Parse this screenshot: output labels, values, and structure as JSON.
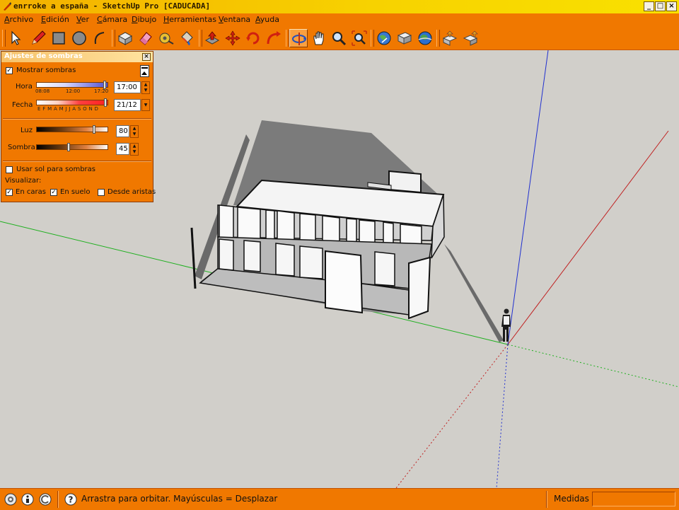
{
  "window": {
    "title": "enrroke a españa - SketchUp Pro [CADUCADA]",
    "buttons": {
      "minimize": "_",
      "maximize": "□",
      "close": "×"
    }
  },
  "menu": [
    "Archivo",
    "Edición",
    "Ver",
    "Cámara",
    "Dibujo",
    "Herramientas",
    "Ventana",
    "Ayuda"
  ],
  "toolbar": {
    "tools": [
      "select-icon",
      "pencil-icon",
      "rectangle-icon",
      "circle-icon",
      "arc-icon",
      "make-component-icon",
      "eraser-icon",
      "tape-measure-icon",
      "paint-bucket-icon",
      "push-pull-icon",
      "move-icon",
      "rotate-icon",
      "follow-me-icon",
      "orbit-icon",
      "pan-icon",
      "zoom-icon",
      "zoom-extents-icon",
      "get-models-icon",
      "share-model-icon",
      "google-earth-icon",
      "import-icon",
      "export-icon"
    ],
    "active_tool": "orbit-icon"
  },
  "shadows_panel": {
    "title": "Ajustes de sombras",
    "close": "×",
    "show_shadows": {
      "label": "Mostrar sombras",
      "checked": true
    },
    "time": {
      "label": "Hora",
      "value": "17:00",
      "ticks": [
        "08:08",
        "12:00",
        "17:20"
      ]
    },
    "date": {
      "label": "Fecha",
      "value": "21/12",
      "months": "E F M A M J J A S O N D"
    },
    "light": {
      "label": "Luz",
      "value": "80"
    },
    "shade": {
      "label": "Sombra",
      "value": "45"
    },
    "use_sun": {
      "label": "Usar sol para sombras",
      "checked": false
    },
    "display": {
      "label": "Visualizar:",
      "on_faces": {
        "label": "En caras",
        "checked": true
      },
      "on_ground": {
        "label": "En suelo",
        "checked": true
      },
      "from_edges": {
        "label": "Desde aristas",
        "checked": false
      }
    }
  },
  "statusbar": {
    "hint": "Arrastra para orbitar.  Mayúsculas = Desplazar",
    "measures_label": "Medidas",
    "measures_value": "",
    "icons": [
      "geo-location-icon",
      "credits-icon",
      "user-icon",
      "help-icon"
    ]
  },
  "colors": {
    "accent": "#f07800",
    "viewport": "#d1cfca",
    "axis_red": "#cc2020",
    "axis_green": "#20b020",
    "axis_blue": "#2020cc"
  }
}
